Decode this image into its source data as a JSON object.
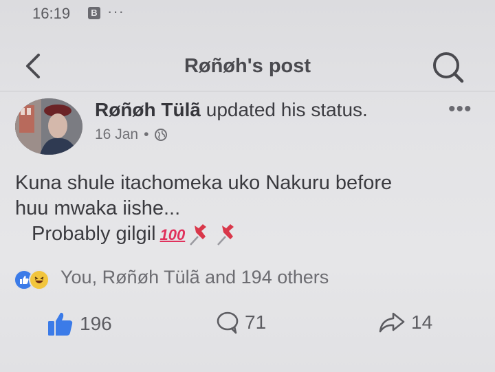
{
  "status_bar": {
    "time": "16:19",
    "app_icon_letter": "B",
    "overflow_dots": "···"
  },
  "header": {
    "title": "Røñøh's post",
    "back_icon": "chevron-left-icon",
    "search_icon": "search-icon"
  },
  "post": {
    "author": "Røñøh  Tülã",
    "action_text": "updated his status.",
    "date": "16 Jan",
    "separator": "•",
    "privacy_icon": "globe-icon",
    "more_label": "•••",
    "lines": [
      "Kuna shule itachomeka uko Nakuru before",
      "huu mwaka iishe...",
      "Probably gilgil"
    ],
    "emoji_100": "100",
    "pin_emoji_count": 2
  },
  "reactions": {
    "summary": "You, Røñøh  Tülã and 194 others",
    "icons": [
      "like-icon",
      "haha-icon"
    ]
  },
  "actions": {
    "like_count": "196",
    "comment_count": "71",
    "share_count": "14"
  },
  "colors": {
    "like_blue": "#3b7be8",
    "haha_yellow": "#f2c53d",
    "emoji_red": "#e0315c",
    "pin_red": "#d9374a"
  }
}
